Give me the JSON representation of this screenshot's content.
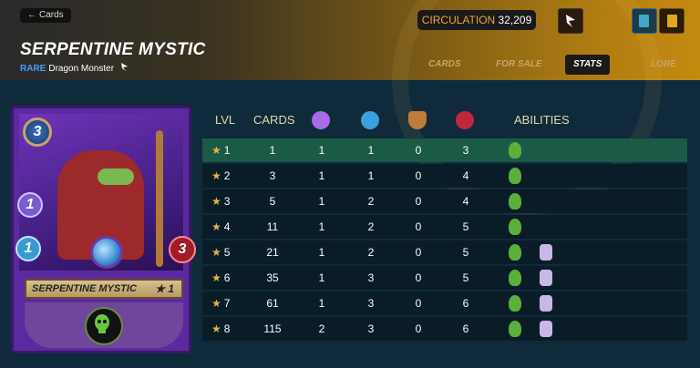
{
  "header": {
    "back_label": "Cards",
    "title": "SERPENTINE MYSTIC",
    "rarity": "RARE",
    "type": "Dragon Monster",
    "circulation_label": "CIRCULATION",
    "circulation_value": "32,209",
    "tabs": [
      "CARDS",
      "FOR SALE",
      "STATS",
      "LORE"
    ],
    "active_tab": "STATS"
  },
  "card": {
    "name": "SERPENTINE MYSTIC",
    "level": "★ 1",
    "mana": "3",
    "attack": "1",
    "speed": "1",
    "health": "3"
  },
  "table": {
    "headers": [
      "LVL",
      "CARDS",
      "ABILITIES"
    ],
    "header_icons": [
      "magic-attack-icon",
      "speed-icon",
      "armor-icon",
      "health-icon"
    ],
    "rows": [
      {
        "lvl": "1",
        "cards": "1",
        "atk": "1",
        "spd": "1",
        "arm": "0",
        "hp": "3",
        "abilities": [
          "skull"
        ]
      },
      {
        "lvl": "2",
        "cards": "3",
        "atk": "1",
        "spd": "1",
        "arm": "0",
        "hp": "4",
        "abilities": [
          "skull"
        ]
      },
      {
        "lvl": "3",
        "cards": "5",
        "atk": "1",
        "spd": "2",
        "arm": "0",
        "hp": "4",
        "abilities": [
          "skull"
        ]
      },
      {
        "lvl": "4",
        "cards": "11",
        "atk": "1",
        "spd": "2",
        "arm": "0",
        "hp": "5",
        "abilities": [
          "skull"
        ]
      },
      {
        "lvl": "5",
        "cards": "21",
        "atk": "1",
        "spd": "2",
        "arm": "0",
        "hp": "5",
        "abilities": [
          "skull",
          "cleanse"
        ]
      },
      {
        "lvl": "6",
        "cards": "35",
        "atk": "1",
        "spd": "3",
        "arm": "0",
        "hp": "5",
        "abilities": [
          "skull",
          "cleanse"
        ]
      },
      {
        "lvl": "7",
        "cards": "61",
        "atk": "1",
        "spd": "3",
        "arm": "0",
        "hp": "6",
        "abilities": [
          "skull",
          "cleanse"
        ]
      },
      {
        "lvl": "8",
        "cards": "115",
        "atk": "2",
        "spd": "3",
        "arm": "0",
        "hp": "6",
        "abilities": [
          "skull",
          "cleanse"
        ]
      }
    ]
  }
}
